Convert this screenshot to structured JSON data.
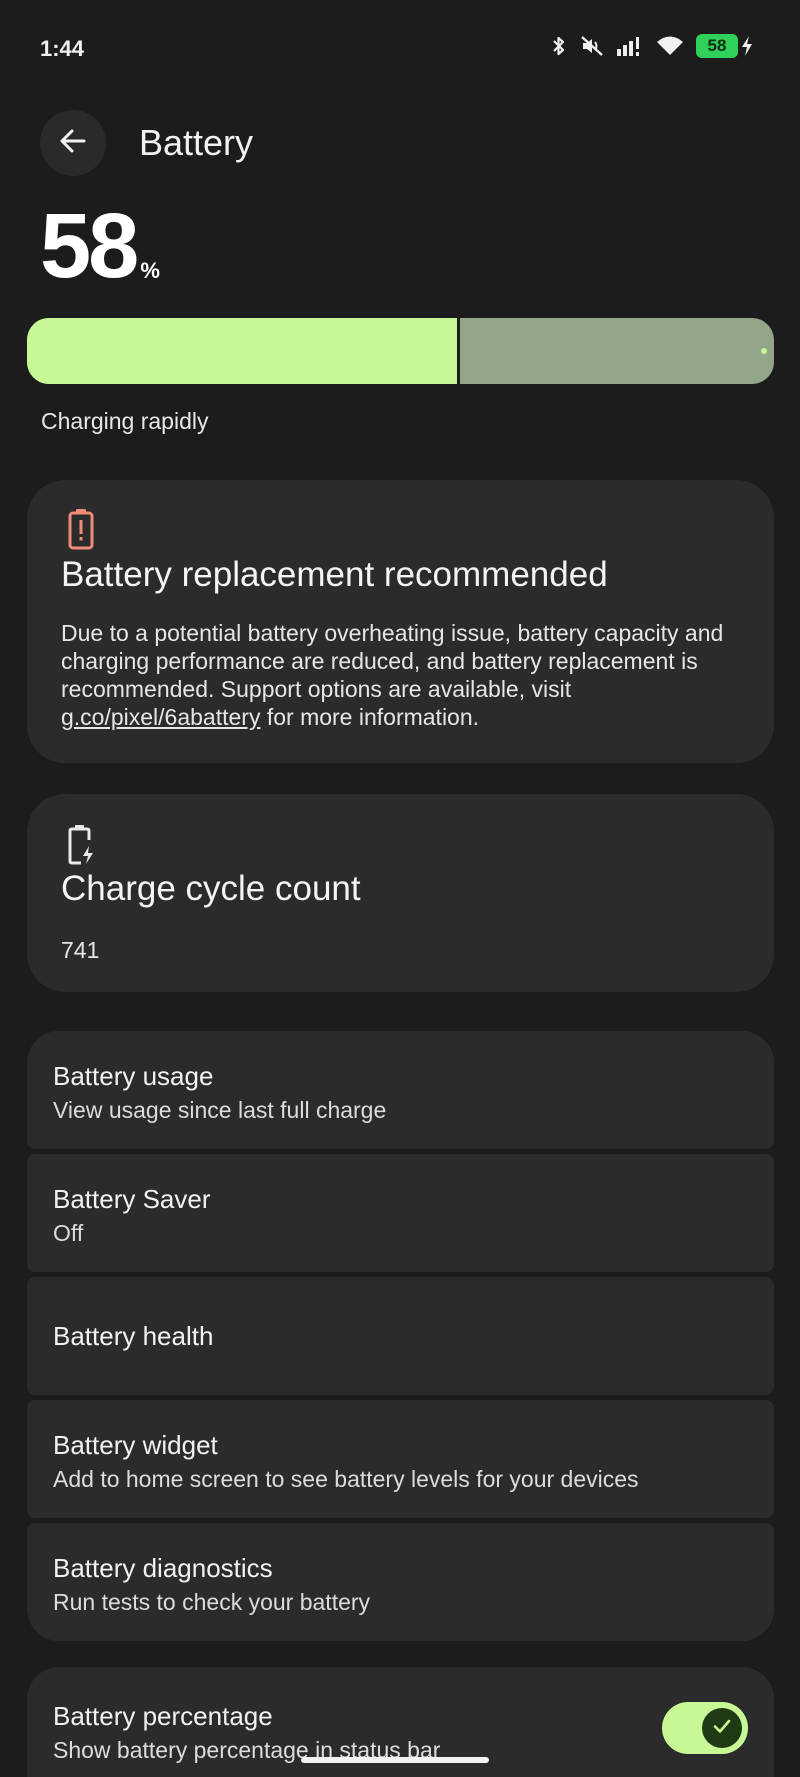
{
  "status_bar": {
    "time": "1:44",
    "battery_level": "58",
    "icons": [
      "bluetooth-icon",
      "mute-icon",
      "signal-icon",
      "wifi-icon",
      "battery-icon",
      "charging-bolt-icon"
    ]
  },
  "header": {
    "back_icon": "arrow-left-icon",
    "title": "Battery"
  },
  "battery": {
    "percent": "58",
    "percent_unit": "%",
    "level_fraction": 0.58,
    "status": "Charging rapidly",
    "colors": {
      "fill": "#c8f896",
      "track": "#93a68a"
    }
  },
  "warning_card": {
    "icon": "battery-alert-icon",
    "icon_color": "#f08a7a",
    "title": "Battery replacement recommended",
    "body_before_link": "Due to a potential battery overheating issue, battery capacity and charging performance are reduced, and battery replacement is recommended. Support options are available, visit ",
    "link_text": "g.co/pixel/6abattery",
    "body_after_link": " for more information."
  },
  "cycle_card": {
    "icon": "battery-charging-icon",
    "title": "Charge cycle count",
    "value": "741"
  },
  "list": [
    {
      "title": "Battery usage",
      "subtitle": "View usage since last full charge"
    },
    {
      "title": "Battery Saver",
      "subtitle": "Off"
    },
    {
      "title": "Battery health",
      "subtitle": ""
    },
    {
      "title": "Battery widget",
      "subtitle": "Add to home screen to see battery levels for your devices"
    },
    {
      "title": "Battery diagnostics",
      "subtitle": "Run tests to check your battery"
    }
  ],
  "percentage_toggle": {
    "title": "Battery percentage",
    "subtitle": "Show battery percentage in status bar",
    "enabled": true,
    "icon": "check-icon"
  }
}
